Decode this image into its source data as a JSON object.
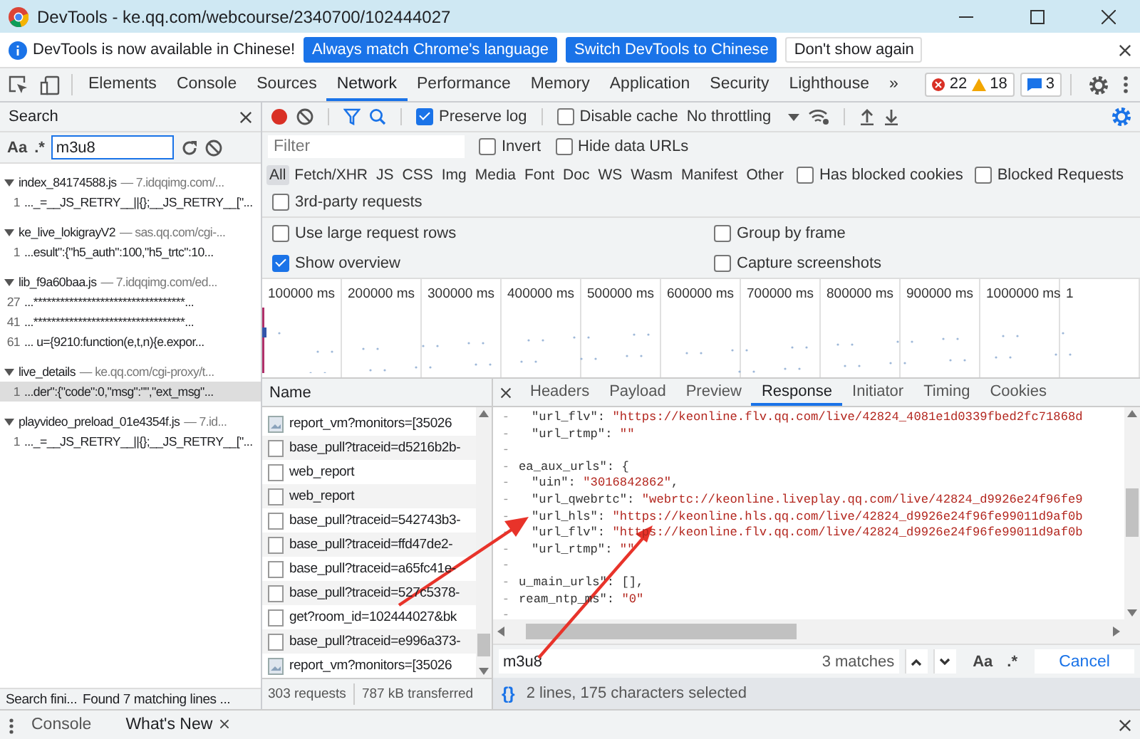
{
  "window": {
    "title": "DevTools - ke.qq.com/webcourse/2340700/102444027"
  },
  "infobar": {
    "message": "DevTools is now available in Chinese!",
    "buttons": [
      {
        "label": "Always match Chrome's language",
        "primary": true
      },
      {
        "label": "Switch DevTools to Chinese",
        "primary": true
      },
      {
        "label": "Don't show again",
        "primary": false
      }
    ]
  },
  "main_tabs": [
    {
      "label": "Elements",
      "selected": false
    },
    {
      "label": "Console",
      "selected": false
    },
    {
      "label": "Sources",
      "selected": false
    },
    {
      "label": "Network",
      "selected": true
    },
    {
      "label": "Performance",
      "selected": false
    },
    {
      "label": "Memory",
      "selected": false
    },
    {
      "label": "Application",
      "selected": false
    },
    {
      "label": "Security",
      "selected": false
    },
    {
      "label": "Lighthouse",
      "selected": false
    }
  ],
  "more_tabs": "»",
  "counters": {
    "errors": "22",
    "warnings": "18",
    "messages": "3"
  },
  "search_panel": {
    "title": "Search",
    "case_label": "Aa",
    "regex_label": ".*",
    "query": "m3u8",
    "results": [
      {
        "file": "index_84174588.js",
        "host": "— 7.idqqimg.com/...",
        "expanded": true,
        "matches": [
          {
            "line": "1",
            "text": "..._=__JS_RETRY__||{};__JS_RETRY__[\"...",
            "selected": false
          }
        ]
      },
      {
        "file": "ke_live_lokigrayV2",
        "host": "— sas.qq.com/cgi-...",
        "expanded": true,
        "matches": [
          {
            "line": "1",
            "text": "...esult\":{\"h5_auth\":100,\"h5_trtc\":10...",
            "selected": false
          }
        ]
      },
      {
        "file": "lib_f9a60baa.js",
        "host": "— 7.idqqimg.com/ed...",
        "expanded": true,
        "matches": [
          {
            "line": "27",
            "text": "...**********************************...",
            "selected": false
          },
          {
            "line": "41",
            "text": "...**********************************...",
            "selected": false
          },
          {
            "line": "61",
            "text": "... u={9210:function(e,t,n){e.expor...",
            "selected": false
          }
        ]
      },
      {
        "file": "live_details",
        "host": "— ke.qq.com/cgi-proxy/t...",
        "expanded": true,
        "matches": [
          {
            "line": "1",
            "text": "...der\":{\"code\":0,\"msg\":\"\",\"ext_msg\"...",
            "selected": true
          }
        ]
      },
      {
        "file": "playvideo_preload_01e4354f.js",
        "host": "— 7.id...",
        "expanded": true,
        "matches": [
          {
            "line": "1",
            "text": "..._=__JS_RETRY__||{};__JS_RETRY__[\"...",
            "selected": false
          }
        ]
      }
    ],
    "status": "Search fini...",
    "found": "Found 7 matching lines ..."
  },
  "network_toolbar": {
    "recording": true,
    "preserve_log": {
      "label": "Preserve log",
      "checked": true
    },
    "disable_cache": {
      "label": "Disable cache",
      "checked": false
    },
    "throttling": "No throttling"
  },
  "filter_bar": {
    "placeholder": "Filter",
    "invert": {
      "label": "Invert",
      "checked": false
    },
    "hide_data_urls": {
      "label": "Hide data URLs",
      "checked": false
    }
  },
  "type_filters": [
    {
      "label": "All",
      "selected": true
    },
    {
      "label": "Fetch/XHR",
      "selected": false
    },
    {
      "label": "JS",
      "selected": false
    },
    {
      "label": "CSS",
      "selected": false
    },
    {
      "label": "Img",
      "selected": false
    },
    {
      "label": "Media",
      "selected": false
    },
    {
      "label": "Font",
      "selected": false
    },
    {
      "label": "Doc",
      "selected": false
    },
    {
      "label": "WS",
      "selected": false
    },
    {
      "label": "Wasm",
      "selected": false
    },
    {
      "label": "Manifest",
      "selected": false
    },
    {
      "label": "Other",
      "selected": false
    }
  ],
  "extra_filters": [
    {
      "label": "Has blocked cookies",
      "checked": false
    },
    {
      "label": "Blocked Requests",
      "checked": false
    },
    {
      "label": "3rd-party requests",
      "checked": false
    }
  ],
  "settings": [
    {
      "label": "Use large request rows",
      "checked": false
    },
    {
      "label": "Group by frame",
      "checked": false
    },
    {
      "label": "Show overview",
      "checked": true
    },
    {
      "label": "Capture screenshots",
      "checked": false
    }
  ],
  "overview_ticks": [
    "100000 ms",
    "200000 ms",
    "300000 ms",
    "400000 ms",
    "500000 ms",
    "600000 ms",
    "700000 ms",
    "800000 ms",
    "900000 ms",
    "1000000 ms",
    "1"
  ],
  "request_list": {
    "column": "Name",
    "rows": [
      {
        "name": "report_vm?monitors=[35026",
        "kind": "image"
      },
      {
        "name": "base_pull?traceid=d5216b2b-",
        "kind": "document"
      },
      {
        "name": "web_report",
        "kind": "document"
      },
      {
        "name": "web_report",
        "kind": "document"
      },
      {
        "name": "base_pull?traceid=542743b3-",
        "kind": "document"
      },
      {
        "name": "base_pull?traceid=ffd47de2-",
        "kind": "document"
      },
      {
        "name": "base_pull?traceid=a65fc41e-",
        "kind": "document"
      },
      {
        "name": "base_pull?traceid=527c5378-",
        "kind": "document"
      },
      {
        "name": "get?room_id=102444027&bk",
        "kind": "document"
      },
      {
        "name": "base_pull?traceid=e996a373-",
        "kind": "document"
      },
      {
        "name": "report_vm?monitors=[35026",
        "kind": "image"
      }
    ],
    "requests": "303 requests",
    "transferred": "787 kB transferred"
  },
  "detail_tabs": [
    {
      "label": "Headers",
      "selected": false
    },
    {
      "label": "Payload",
      "selected": false
    },
    {
      "label": "Preview",
      "selected": false
    },
    {
      "label": "Response",
      "selected": true
    },
    {
      "label": "Initiator",
      "selected": false
    },
    {
      "label": "Timing",
      "selected": false
    },
    {
      "label": "Cookies",
      "selected": false
    }
  ],
  "response_lines": [
    {
      "gutter": "-",
      "indent": true,
      "key": "\"url_flv\"",
      "punct": ": ",
      "value": "\"https://keonline.flv.qq.com/live/42824_4081e1d0339fbed2fc71868d"
    },
    {
      "gutter": "-",
      "indent": true,
      "key": "\"url_rtmp\"",
      "punct": ": ",
      "value": "\"\""
    },
    {
      "gutter": "-"
    },
    {
      "gutter": "-",
      "indent": false,
      "key": "ea_aux_urls\"",
      "punct": ": {"
    },
    {
      "gutter": "-",
      "indent": true,
      "key": "\"uin\"",
      "punct": ": ",
      "value": "\"3016842862\"",
      "tail": ","
    },
    {
      "gutter": "-",
      "indent": true,
      "key": "\"url_qwebrtc\"",
      "punct": ": ",
      "value": "\"webrtc://keonline.liveplay.qq.com/live/42824_d9926e24f96fe9"
    },
    {
      "gutter": "-",
      "indent": true,
      "key": "\"url_hls\"",
      "punct": ": ",
      "value": "\"https://keonline.hls.qq.com/live/42824_d9926e24f96fe99011d9af0b"
    },
    {
      "gutter": "-",
      "indent": true,
      "key": "\"url_flv\"",
      "punct": ": ",
      "value": "\"https://keonline.flv.qq.com/live/42824_d9926e24f96fe99011d9af0b"
    },
    {
      "gutter": "-",
      "indent": true,
      "key": "\"url_rtmp\"",
      "punct": ": ",
      "value": "\"\""
    },
    {
      "gutter": "-"
    },
    {
      "gutter": "-",
      "indent": false,
      "key": "u_main_urls\"",
      "punct": ": [],"
    },
    {
      "gutter": "-",
      "indent": false,
      "key": "ream_ntp_ms\"",
      "punct": ": ",
      "value": "\"0\""
    },
    {
      "gutter": "-"
    }
  ],
  "find_bar": {
    "query": "m3u8",
    "count": "3 matches",
    "case_label": "Aa",
    "regex_label": ".*",
    "cancel": "Cancel"
  },
  "status": {
    "format_label": "{}",
    "selection": "2 lines, 175 characters selected"
  },
  "drawer_tabs": [
    {
      "label": "Console",
      "selected": false,
      "closable": false
    },
    {
      "label": "What's New",
      "selected": true,
      "closable": true
    }
  ]
}
